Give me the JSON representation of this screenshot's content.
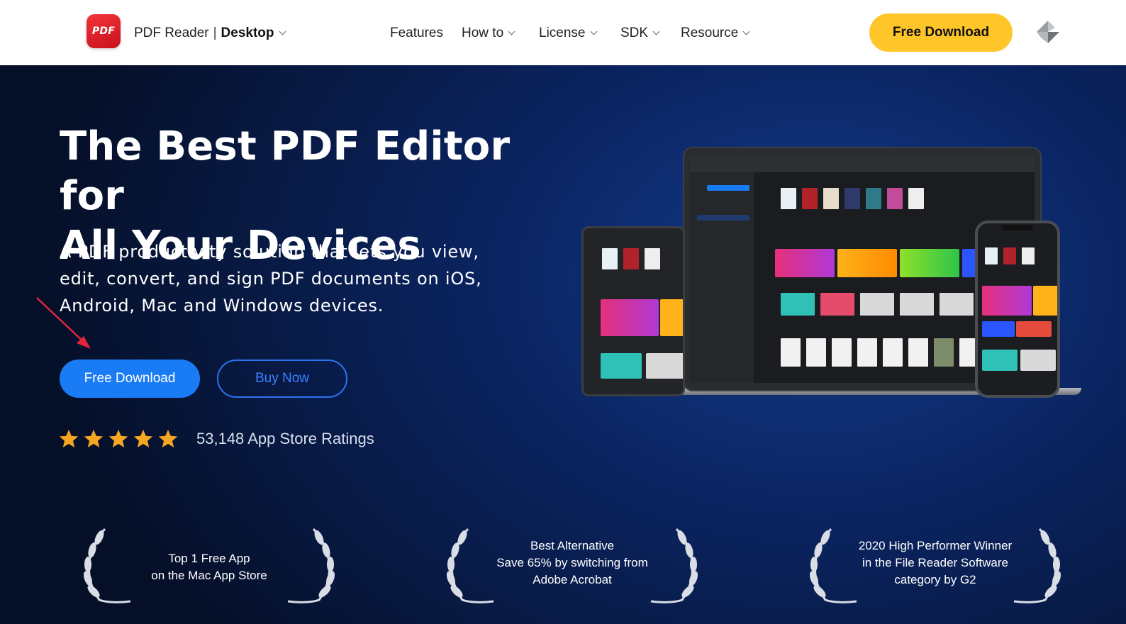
{
  "header": {
    "logo_text": "PDF",
    "brand_name": "PDF Reader",
    "brand_separator": "|",
    "brand_product": "Desktop",
    "nav": [
      {
        "label": "Features",
        "dropdown": false
      },
      {
        "label": "How to",
        "dropdown": true
      },
      {
        "label": "License",
        "dropdown": true
      },
      {
        "label": "SDK",
        "dropdown": true
      },
      {
        "label": "Resource",
        "dropdown": true
      }
    ],
    "download_label": "Free Download",
    "right_icon": "kdan-logo-icon"
  },
  "hero": {
    "title_line1": "The Best PDF Editor for",
    "title_line2": "All Your Devices",
    "subtitle_line1": "A PDF productivity solution that lets you view,",
    "subtitle_line2": "edit, convert, and sign PDF documents on iOS,",
    "subtitle_line3": "Android, Mac and Windows devices.",
    "primary_button": "Free Download",
    "secondary_button": "Buy Now",
    "rating_stars": 5,
    "ratings_text": "53,148 App Store Ratings"
  },
  "awards": [
    {
      "lines": [
        "Top 1 Free App",
        "on the Mac App Store"
      ]
    },
    {
      "lines": [
        "Best Alternative",
        "Save 65% by switching from",
        "Adobe Acrobat"
      ]
    },
    {
      "lines": [
        "2020 High Performer Winner",
        "in the File Reader Software",
        "category by G2"
      ]
    }
  ],
  "colors": {
    "brand_red": "#e3232c",
    "accent_yellow": "#ffc629",
    "primary_blue": "#1a7cf4",
    "star": "#f5a623",
    "annotation_arrow": "#e0263d"
  }
}
